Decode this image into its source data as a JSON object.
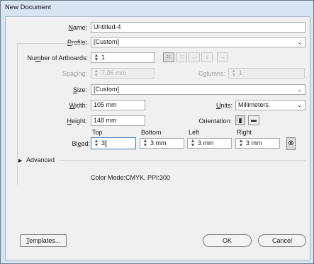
{
  "window": {
    "title": "New Document"
  },
  "name": {
    "label": "Name:",
    "value": "Untitled-4"
  },
  "profile": {
    "label": "Profile:",
    "value": "[Custom]"
  },
  "artboards": {
    "label": "Number of Artboards:",
    "value": "1"
  },
  "spacing": {
    "label": "Spacing:",
    "value": "7,06 mm"
  },
  "columns": {
    "label": "Columns:",
    "value": "1"
  },
  "size": {
    "label": "Size:",
    "value": "[Custom]"
  },
  "width": {
    "label": "Width:",
    "value": "105 mm"
  },
  "units": {
    "label": "Units:",
    "value": "Millimeters"
  },
  "height": {
    "label": "Height:",
    "value": "148 mm"
  },
  "orientation": {
    "label": "Orientation:"
  },
  "bleed": {
    "label": "Bleed:",
    "headers": {
      "top": "Top",
      "bottom": "Bottom",
      "left": "Left",
      "right": "Right"
    },
    "values": {
      "top": "3",
      "bottom": "3 mm",
      "left": "3 mm",
      "right": "3 mm"
    }
  },
  "advanced": {
    "label": "Advanced"
  },
  "info": {
    "text": "Color Mode:CMYK, PPI:300"
  },
  "buttons": {
    "templates": "Templates...",
    "ok": "OK",
    "cancel": "Cancel"
  },
  "icons": {
    "arrange_grid_rows": "grid-by-row-icon",
    "arrange_grid_cols": "grid-by-column-icon",
    "arrange_row": "arrange-by-row-icon",
    "arrange_column": "arrange-by-column-icon",
    "rtl": "right-to-left-icon",
    "portrait": "portrait-icon",
    "landscape": "landscape-icon",
    "link": "chain-link-icon",
    "expand": "triangle-right-icon"
  }
}
